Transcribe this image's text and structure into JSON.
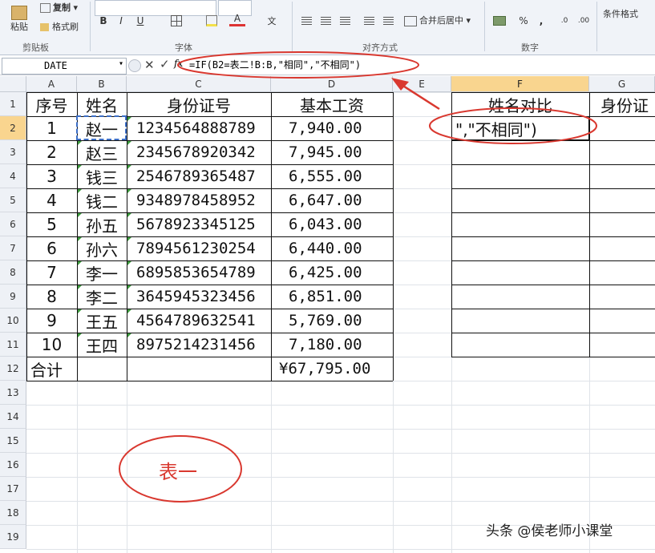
{
  "ribbon": {
    "paste_label": "粘贴",
    "copy_label": "复制",
    "format_painter_label": "格式刷",
    "clipboard_group": "剪贴板",
    "bold": "B",
    "italic": "I",
    "underline": "U",
    "font_color_letter": "A",
    "font_group": "字体",
    "merge_label": "合并后居中",
    "alignment_group": "对齐方式",
    "percent": "%",
    "comma": ",",
    "number_group": "数字",
    "conditional_label": "条件格式"
  },
  "formula_bar": {
    "name_box": "DATE",
    "fx": "fx",
    "formula": "=IF(B2=表二!B:B,\"相同\",\"不相同\")"
  },
  "columns": [
    "A",
    "B",
    "C",
    "D",
    "E",
    "F",
    "G"
  ],
  "rows": [
    "1",
    "2",
    "3",
    "4",
    "5",
    "6",
    "7",
    "8",
    "9",
    "10",
    "11",
    "12",
    "13",
    "14",
    "15",
    "16",
    "17",
    "18",
    "19"
  ],
  "table": {
    "headers": [
      "序号",
      "姓名",
      "身份证号",
      "基本工资"
    ],
    "rows": [
      [
        "1",
        "赵一",
        "1234564888789",
        "7,940.00"
      ],
      [
        "2",
        "赵三",
        "2345678920342",
        "7,945.00"
      ],
      [
        "3",
        "钱三",
        "2546789365487",
        "6,555.00"
      ],
      [
        "4",
        "钱二",
        "9348978458952",
        "6,647.00"
      ],
      [
        "5",
        "孙五",
        "5678923345125",
        "6,043.00"
      ],
      [
        "6",
        "孙六",
        "7894561230254",
        "6,440.00"
      ],
      [
        "7",
        "李一",
        "6895853654789",
        "6,425.00"
      ],
      [
        "8",
        "李二",
        "3645945323456",
        "6,851.00"
      ],
      [
        "9",
        "王五",
        "4564789632541",
        "5,769.00"
      ],
      [
        "10",
        "王四",
        "8975214231456",
        "7,180.00"
      ]
    ],
    "total_label": "合计",
    "total_value": "¥67,795.00"
  },
  "compare": {
    "header_f": "姓名对比",
    "header_g": "身份证",
    "editing_text": "\",\"不相同\")"
  },
  "annotation": {
    "circle_label": "表一",
    "color": "#d9382f"
  },
  "watermark": "头条 @侯老师小课堂"
}
